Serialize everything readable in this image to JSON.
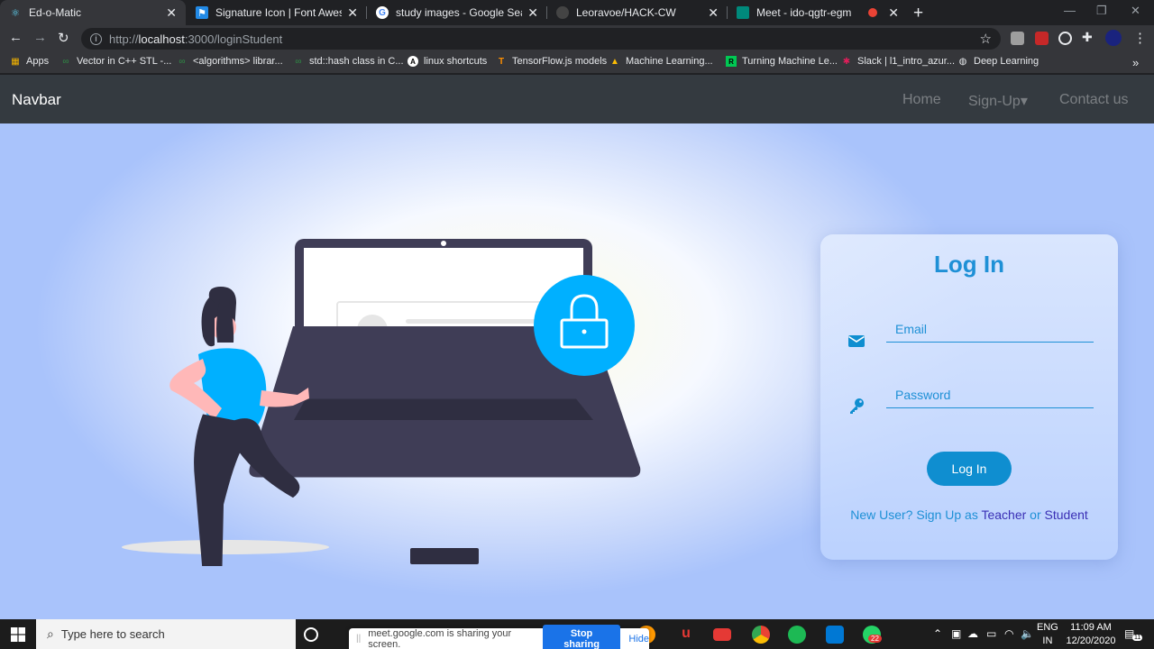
{
  "browser": {
    "tabs": [
      {
        "title": "Ed-o-Matic",
        "icon": "react-icon",
        "active": true
      },
      {
        "title": "Signature Icon | Font Awesome",
        "icon": "font-awesome-icon"
      },
      {
        "title": "study images - Google Search",
        "icon": "google-icon"
      },
      {
        "title": "Leoravoe/HACK-CW",
        "icon": "github-icon"
      },
      {
        "title": "Meet - ido-qgtr-egm",
        "icon": "meet-icon"
      }
    ],
    "new_tab": "+",
    "url_prefix": "http://",
    "url_host": "localhost",
    "url_path": ":3000/loginStudent",
    "bookmarks": [
      "Apps",
      "Vector in C++ STL -...",
      "<algorithms> librar...",
      "std::hash class in C...",
      "linux shortcuts",
      "TensorFlow.js models",
      "Machine Learning...",
      "Turning Machine Le...",
      "Slack | l1_intro_azur...",
      "Deep Learning"
    ],
    "bookmarks_more": "»"
  },
  "navbar": {
    "brand": "Navbar",
    "links": [
      "Home",
      "Sign-Up",
      "Contact us"
    ],
    "dropdown_caret": "▾"
  },
  "login": {
    "title": "Log In",
    "email_placeholder": "Email",
    "password_placeholder": "Password",
    "button": "Log In",
    "signup_prefix": "New User? Sign Up as ",
    "teacher_link": "Teacher",
    "or": " or ",
    "student_link": "Student"
  },
  "taskbar": {
    "search_placeholder": "Type here to search",
    "share_message": "meet.google.com is sharing your screen.",
    "stop_sharing": "Stop sharing",
    "hide": "Hide",
    "lang_line1": "ENG",
    "lang_line2": "IN",
    "time": "11:09 AM",
    "date": "12/20/2020",
    "notification_count": "22",
    "action_center_count": "11"
  },
  "colors": {
    "accent": "#1e90d6",
    "button": "#0f8ed0",
    "link": "#3a2fb5",
    "navbar": "#343a40",
    "illustration_accent": "#00b0ff",
    "laptop": "#3f3d56"
  }
}
